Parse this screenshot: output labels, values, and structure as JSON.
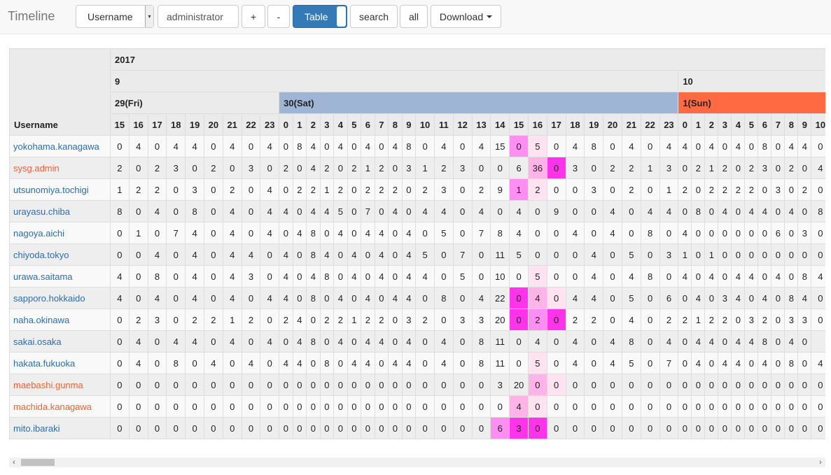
{
  "navbar": {
    "brand": "Timeline",
    "field_select": "Username",
    "user_value": "administrator",
    "plus_label": "+",
    "minus_label": "-",
    "table_label": "Table",
    "search_label": "search",
    "all_label": "all",
    "download_label": "Download"
  },
  "table": {
    "year": "2017",
    "month_sep": "9",
    "month_oct": "10",
    "day_fri": "29(Fri)",
    "day_sat": "30(Sat)",
    "day_sun": "1(Sun)",
    "username_header": "Username",
    "hours_fri": [
      "15",
      "16",
      "17",
      "18",
      "19",
      "20",
      "21",
      "22",
      "23"
    ],
    "hours_sat": [
      "0",
      "1",
      "2",
      "3",
      "4",
      "5",
      "6",
      "7",
      "8",
      "9",
      "10",
      "11",
      "12",
      "13",
      "14",
      "15",
      "16",
      "17",
      "18",
      "19",
      "20",
      "21",
      "22",
      "23"
    ],
    "hours_sun": [
      "0",
      "1",
      "2",
      "3",
      "4",
      "5",
      "6",
      "7",
      "8",
      "9",
      "10"
    ],
    "rows": [
      {
        "user": "yokohama.kanagawa",
        "color": "blue",
        "values": [
          "0",
          "4",
          "0",
          "4",
          "4",
          "0",
          "4",
          "0",
          "4",
          "0",
          "8",
          "4",
          "0",
          "4",
          "0",
          "4",
          "0",
          "4",
          "8",
          "0",
          "4",
          "0",
          "4",
          "15",
          "0",
          "5",
          "0",
          "4",
          "8",
          "0",
          "4",
          "0",
          "4",
          "4",
          "0",
          "4",
          "0",
          "4",
          "0",
          "8",
          "0",
          "4",
          "4",
          "0"
        ]
      },
      {
        "user": "sysg.admin",
        "color": "orange",
        "values": [
          "2",
          "0",
          "2",
          "3",
          "0",
          "2",
          "0",
          "3",
          "0",
          "2",
          "0",
          "4",
          "2",
          "0",
          "2",
          "1",
          "2",
          "0",
          "3",
          "1",
          "2",
          "3",
          "0",
          "0",
          "6",
          "36",
          "0",
          "3",
          "0",
          "2",
          "2",
          "1",
          "3",
          "0",
          "2",
          "1",
          "2",
          "0",
          "2",
          "3",
          "0",
          "2",
          "0",
          "4"
        ]
      },
      {
        "user": "utsunomiya.tochigi",
        "color": "blue",
        "values": [
          "1",
          "2",
          "2",
          "0",
          "3",
          "0",
          "2",
          "0",
          "4",
          "0",
          "2",
          "2",
          "1",
          "2",
          "0",
          "2",
          "2",
          "2",
          "0",
          "2",
          "3",
          "0",
          "2",
          "9",
          "1",
          "2",
          "0",
          "0",
          "3",
          "0",
          "2",
          "0",
          "1",
          "2",
          "0",
          "2",
          "2",
          "2",
          "2",
          "0",
          "3",
          "0",
          "2",
          "0"
        ]
      },
      {
        "user": "urayasu.chiba",
        "color": "blue",
        "values": [
          "8",
          "0",
          "4",
          "0",
          "8",
          "0",
          "4",
          "0",
          "4",
          "4",
          "0",
          "4",
          "4",
          "5",
          "0",
          "7",
          "0",
          "4",
          "0",
          "4",
          "4",
          "0",
          "4",
          "0",
          "4",
          "0",
          "9",
          "0",
          "0",
          "4",
          "0",
          "4",
          "4",
          "0",
          "8",
          "0",
          "4",
          "0",
          "4",
          "4",
          "0",
          "4",
          "0",
          "8",
          "4"
        ]
      },
      {
        "user": "nagoya.aichi",
        "color": "blue",
        "values": [
          "0",
          "1",
          "0",
          "7",
          "4",
          "0",
          "4",
          "0",
          "4",
          "0",
          "4",
          "8",
          "0",
          "4",
          "0",
          "4",
          "4",
          "0",
          "4",
          "0",
          "5",
          "0",
          "7",
          "8",
          "4",
          "0",
          "0",
          "4",
          "0",
          "4",
          "0",
          "8",
          "0",
          "4",
          "0",
          "0",
          "0",
          "0",
          "0",
          "0",
          "6",
          "0",
          "3",
          "0"
        ]
      },
      {
        "user": "chiyoda.tokyo",
        "color": "blue",
        "values": [
          "0",
          "0",
          "4",
          "0",
          "4",
          "0",
          "4",
          "4",
          "0",
          "4",
          "0",
          "8",
          "4",
          "0",
          "4",
          "0",
          "4",
          "0",
          "4",
          "5",
          "0",
          "7",
          "0",
          "11",
          "5",
          "0",
          "0",
          "0",
          "4",
          "0",
          "5",
          "0",
          "3",
          "1",
          "0",
          "1",
          "0",
          "0",
          "0",
          "0",
          "0",
          "0",
          "0",
          "0"
        ]
      },
      {
        "user": "urawa.saitama",
        "color": "blue",
        "values": [
          "4",
          "0",
          "8",
          "0",
          "4",
          "0",
          "4",
          "3",
          "0",
          "4",
          "0",
          "4",
          "8",
          "0",
          "4",
          "0",
          "4",
          "0",
          "4",
          "4",
          "0",
          "5",
          "0",
          "10",
          "0",
          "5",
          "0",
          "0",
          "4",
          "0",
          "4",
          "8",
          "0",
          "4",
          "0",
          "4",
          "0",
          "4",
          "4",
          "0",
          "4",
          "0",
          "8",
          "4"
        ]
      },
      {
        "user": "sapporo.hokkaido",
        "color": "blue",
        "values": [
          "4",
          "0",
          "4",
          "0",
          "4",
          "0",
          "4",
          "0",
          "4",
          "4",
          "0",
          "8",
          "0",
          "4",
          "0",
          "4",
          "0",
          "4",
          "4",
          "0",
          "8",
          "0",
          "4",
          "22",
          "0",
          "4",
          "0",
          "4",
          "4",
          "0",
          "5",
          "0",
          "6",
          "0",
          "4",
          "0",
          "3",
          "4",
          "0",
          "4",
          "0",
          "8",
          "4",
          "0"
        ]
      },
      {
        "user": "naha.okinawa",
        "color": "blue",
        "values": [
          "0",
          "2",
          "3",
          "0",
          "2",
          "2",
          "1",
          "2",
          "0",
          "2",
          "4",
          "0",
          "2",
          "2",
          "1",
          "2",
          "2",
          "0",
          "3",
          "2",
          "0",
          "3",
          "3",
          "20",
          "0",
          "2",
          "0",
          "2",
          "2",
          "0",
          "4",
          "0",
          "2",
          "2",
          "1",
          "2",
          "2",
          "0",
          "3",
          "2",
          "0",
          "3",
          "3",
          "0"
        ]
      },
      {
        "user": "sakai.osaka",
        "color": "blue",
        "values": [
          "0",
          "4",
          "0",
          "4",
          "4",
          "0",
          "4",
          "0",
          "4",
          "0",
          "4",
          "8",
          "0",
          "4",
          "0",
          "4",
          "4",
          "0",
          "4",
          "0",
          "4",
          "0",
          "8",
          "11",
          "0",
          "4",
          "0",
          "4",
          "0",
          "4",
          "8",
          "0",
          "4",
          "0",
          "4",
          "4",
          "0",
          "4",
          "4",
          "8",
          "0",
          "4",
          "0"
        ]
      },
      {
        "user": "hakata.fukuoka",
        "color": "blue",
        "values": [
          "0",
          "4",
          "0",
          "8",
          "0",
          "4",
          "0",
          "4",
          "0",
          "4",
          "4",
          "0",
          "8",
          "0",
          "4",
          "4",
          "0",
          "4",
          "4",
          "0",
          "4",
          "0",
          "8",
          "11",
          "0",
          "5",
          "0",
          "4",
          "0",
          "4",
          "5",
          "0",
          "7",
          "0",
          "4",
          "0",
          "4",
          "4",
          "0",
          "4",
          "0",
          "8",
          "0",
          "4"
        ]
      },
      {
        "user": "maebashi.gunma",
        "color": "orange",
        "values": [
          "0",
          "0",
          "0",
          "0",
          "0",
          "0",
          "0",
          "0",
          "0",
          "0",
          "0",
          "0",
          "0",
          "0",
          "0",
          "0",
          "0",
          "0",
          "0",
          "0",
          "0",
          "0",
          "0",
          "3",
          "20",
          "0",
          "0",
          "0",
          "0",
          "0",
          "0",
          "0",
          "0",
          "0",
          "0",
          "0",
          "0",
          "0",
          "0",
          "0",
          "0",
          "0",
          "0",
          "0"
        ]
      },
      {
        "user": "machida.kanagawa",
        "color": "orange",
        "values": [
          "0",
          "0",
          "0",
          "0",
          "0",
          "0",
          "0",
          "0",
          "0",
          "0",
          "0",
          "0",
          "0",
          "0",
          "0",
          "0",
          "0",
          "0",
          "0",
          "0",
          "0",
          "0",
          "0",
          "0",
          "4",
          "0",
          "0",
          "0",
          "0",
          "0",
          "0",
          "0",
          "0",
          "0",
          "0",
          "0",
          "0",
          "0",
          "0",
          "0",
          "0",
          "0",
          "0",
          "0"
        ]
      },
      {
        "user": "mito.ibaraki",
        "color": "blue",
        "values": [
          "0",
          "0",
          "0",
          "0",
          "0",
          "0",
          "0",
          "0",
          "0",
          "0",
          "0",
          "0",
          "0",
          "0",
          "0",
          "0",
          "0",
          "0",
          "0",
          "0",
          "0",
          "0",
          "0",
          "6",
          "3",
          "0",
          "0",
          "0",
          "0",
          "0",
          "0",
          "0",
          "0",
          "0",
          "0",
          "0",
          "0",
          "0",
          "0",
          "0",
          "0",
          "0",
          "0",
          "0"
        ]
      }
    ],
    "highlights": {
      "0": {
        "24": "h3",
        "25": "h1"
      },
      "1": {
        "25": "h2",
        "26": "h4"
      },
      "2": {
        "24": "h3",
        "25": "h1"
      },
      "6": {
        "25": "h1"
      },
      "7": {
        "24": "h4",
        "25": "h2",
        "26": "h1"
      },
      "8": {
        "24": "h4",
        "25": "h3",
        "26": "h4"
      },
      "9": {},
      "10": {
        "25": "h1"
      },
      "11": {
        "25": "h2",
        "26": "h1"
      },
      "12": {
        "24": "h2",
        "25": "h1"
      },
      "13": {
        "23": "h3",
        "24": "h4",
        "25": "h4"
      }
    }
  },
  "colors": {
    "accent": "#337ab7",
    "saturday": "#9fb5d5",
    "sunday": "#ff6a43",
    "link_blue": "#2a6db0",
    "link_orange": "#e8643a"
  }
}
